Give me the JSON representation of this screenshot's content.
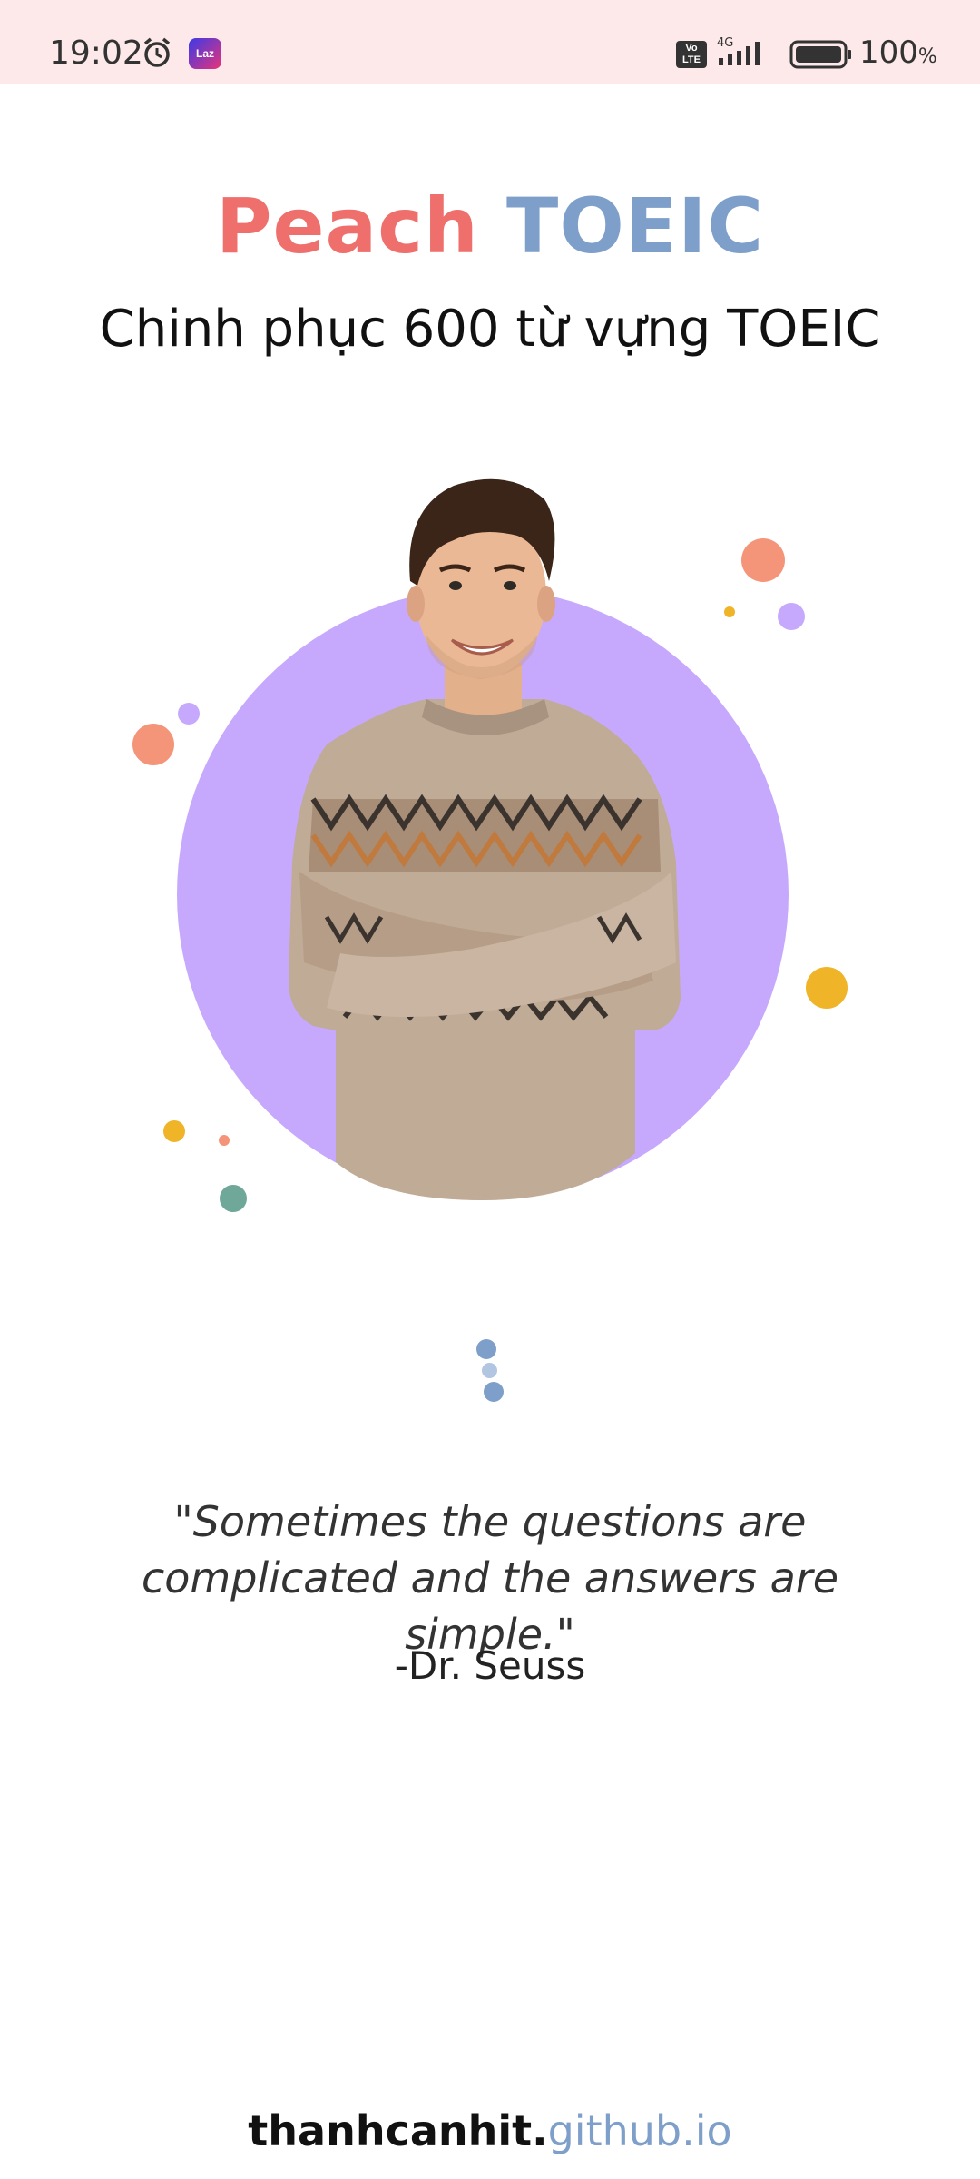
{
  "status_bar": {
    "time": "19:02",
    "volte": "Vo LTE",
    "network": "4G",
    "battery_percent": "100",
    "percent_sign": "%",
    "app_icon_label": "Laz"
  },
  "header": {
    "title_part1": "Peach",
    "title_part2": "TOEIC",
    "subtitle": "Chinh phục 600 từ vựng TOEIC"
  },
  "quote": {
    "text": "\"Sometimes the questions are complicated and the answers are simple.\"",
    "author": "-Dr. Seuss"
  },
  "footer": {
    "domain_part1": "thanhcanhit.",
    "domain_part2": "github.io"
  },
  "colors": {
    "status_bar_bg": "#fde9e9",
    "peach": "#ee6f6b",
    "toeic_blue": "#7e9fca",
    "circle_purple": "#c6a9fd",
    "accent_orange": "#f4957a",
    "accent_yellow": "#f0b429",
    "accent_teal": "#6fa898"
  },
  "icons": [
    "alarm-icon",
    "app-notification-icon",
    "volte-icon",
    "signal-icon",
    "battery-icon"
  ]
}
